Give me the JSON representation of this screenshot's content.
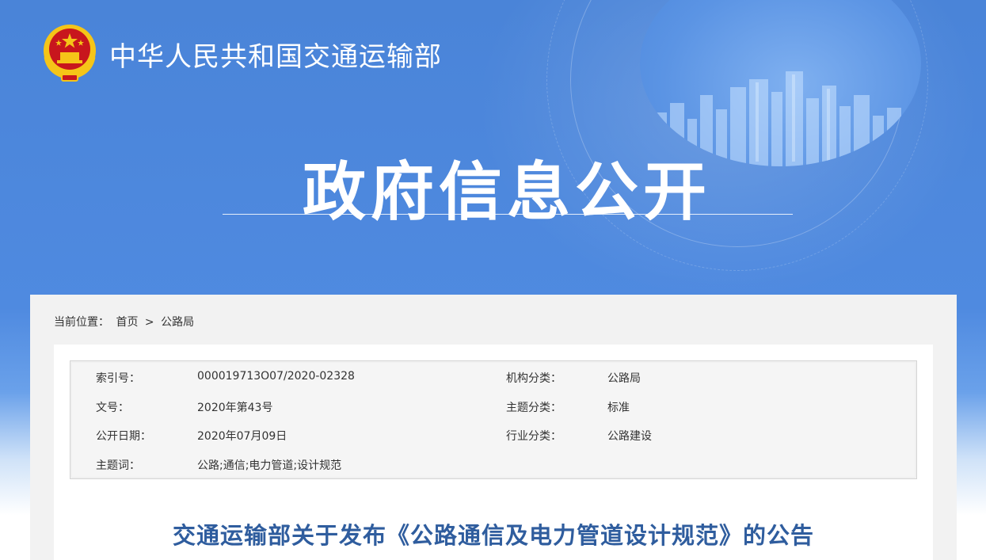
{
  "header": {
    "site_name": "中华人民共和国交通运输部",
    "hero_title": "政府信息公开"
  },
  "breadcrumb": {
    "prefix": "当前位置：",
    "home": "首页",
    "separator": ">",
    "current": "公路局"
  },
  "meta": {
    "rows": [
      {
        "label1": "索引号：",
        "value1": "000019713O07/2020-02328",
        "label2": "机构分类：",
        "value2": "公路局"
      },
      {
        "label1": "文号：",
        "value1": "2020年第43号",
        "label2": "主题分类：",
        "value2": "标准"
      },
      {
        "label1": "公开日期：",
        "value1": "2020年07月09日",
        "label2": "行业分类：",
        "value2": "公路建设"
      },
      {
        "label1": "主题词：",
        "value1": "公路;通信;电力管道;设计规范"
      }
    ]
  },
  "document": {
    "title": "交通运输部关于发布《公路通信及电力管道设计规范》的公告"
  },
  "colors": {
    "banner_blue": "#4f8ae0",
    "title_blue": "#2f5d9e",
    "emblem_red": "#c8161d",
    "emblem_gold": "#f5c518"
  }
}
